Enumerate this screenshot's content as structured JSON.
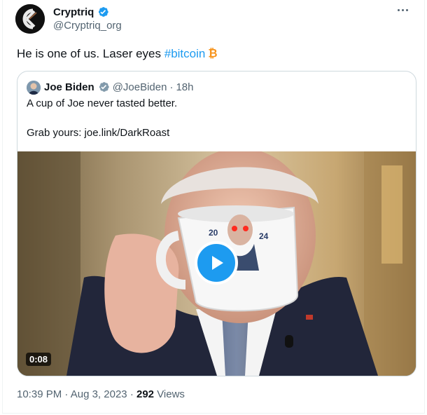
{
  "tweet": {
    "display_name": "Cryptriq",
    "handle": "@Cryptriq_org",
    "text_main": "He is one of us. Laser eyes ",
    "hashtag": "#bitcoin",
    "time": "10:39 PM",
    "date": "Aug 3, 2023",
    "views_count": "292",
    "views_label": "Views"
  },
  "quote": {
    "display_name": "Joe Biden",
    "handle": "@JoeBiden",
    "age": "18h",
    "line1": "A cup of Joe never tasted better.",
    "line2": "Grab yours: joe.link/DarkRoast",
    "video_duration": "0:08",
    "mug_text_left": "20",
    "mug_text_right": "24"
  },
  "icons": [
    "verified-badge-icon",
    "more-icon",
    "bitcoin-icon",
    "play-icon"
  ],
  "colors": {
    "accent": "#1d9bf0",
    "text": "#0f1419",
    "muted": "#536471",
    "bitcoin": "#f7931a"
  }
}
